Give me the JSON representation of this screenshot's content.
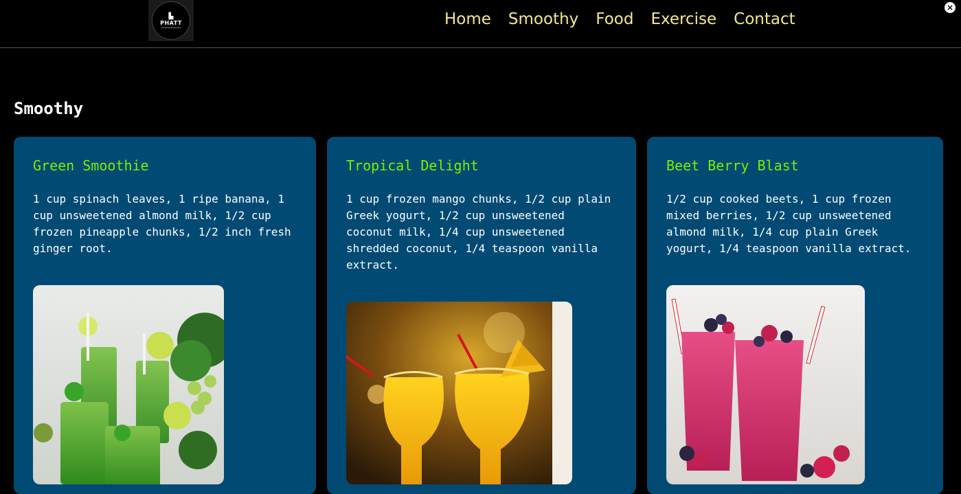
{
  "header": {
    "logo_text": "PHATT",
    "nav": [
      "Home",
      "Smoothy",
      "Food",
      "Exercise",
      "Contact"
    ],
    "close_label": "×"
  },
  "section": {
    "title": "Smoothy"
  },
  "cards": [
    {
      "title": "Green Smoothie",
      "ingredients": "1 cup spinach leaves, 1 ripe banana, 1 cup unsweetened almond milk, 1/2 cup frozen pineapple chunks, 1/2 inch fresh ginger root.",
      "image": "green-smoothie-photo"
    },
    {
      "title": "Tropical Delight",
      "ingredients": "1 cup frozen mango chunks, 1/2 cup plain Greek yogurt, 1/2 cup unsweetened coconut milk, 1/4 cup unsweetened shredded coconut, 1/4 teaspoon vanilla extract.",
      "image": "tropical-delight-photo"
    },
    {
      "title": "Beet Berry Blast",
      "ingredients": "1/2 cup cooked beets, 1 cup frozen mixed berries, 1/2 cup unsweetened almond milk, 1/4 cup plain Greek yogurt, 1/4 teaspoon vanilla extract.",
      "image": "beet-berry-blast-photo"
    }
  ],
  "colors": {
    "background": "#000000",
    "nav_link": "#f5e98a",
    "card_bg": "#004a74",
    "card_title": "#7cf000",
    "card_text": "#ffffff"
  }
}
